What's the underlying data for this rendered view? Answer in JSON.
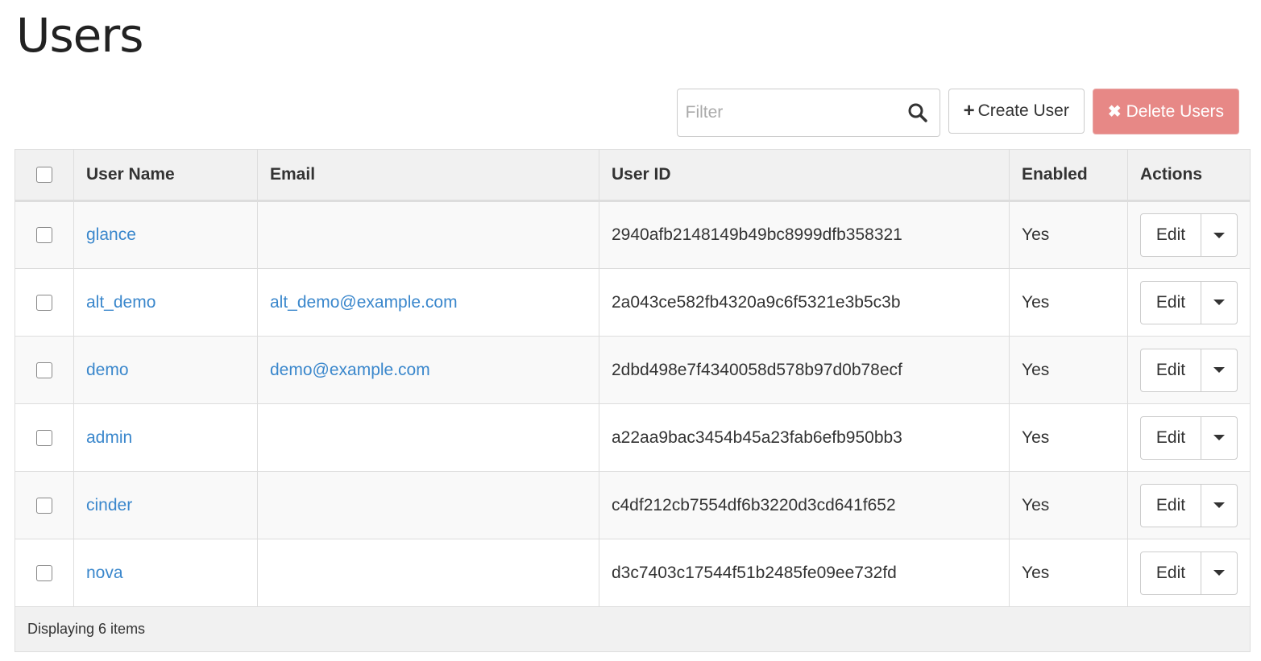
{
  "page": {
    "title": "Users"
  },
  "toolbar": {
    "filter_placeholder": "Filter",
    "create_label": "Create User",
    "create_glyph": "+",
    "delete_label": "Delete Users",
    "delete_glyph": "✖",
    "delete_color": "#e78886"
  },
  "table": {
    "headers": {
      "name": "User Name",
      "email": "Email",
      "id": "User ID",
      "enabled": "Enabled",
      "actions": "Actions"
    },
    "rows": [
      {
        "name": "glance",
        "email": "",
        "id": "2940afb2148149b49bc8999dfb358321",
        "enabled": "Yes",
        "action": "Edit"
      },
      {
        "name": "alt_demo",
        "email": "alt_demo@example.com",
        "id": "2a043ce582fb4320a9c6f5321e3b5c3b",
        "enabled": "Yes",
        "action": "Edit"
      },
      {
        "name": "demo",
        "email": "demo@example.com",
        "id": "2dbd498e7f4340058d578b97d0b78ecf",
        "enabled": "Yes",
        "action": "Edit"
      },
      {
        "name": "admin",
        "email": "",
        "id": "a22aa9bac3454b45a23fab6efb950bb3",
        "enabled": "Yes",
        "action": "Edit"
      },
      {
        "name": "cinder",
        "email": "",
        "id": "c4df212cb7554df6b3220d3cd641f652",
        "enabled": "Yes",
        "action": "Edit"
      },
      {
        "name": "nova",
        "email": "",
        "id": "d3c7403c17544f51b2485fe09ee732fd",
        "enabled": "Yes",
        "action": "Edit"
      }
    ],
    "footer": "Displaying 6 items"
  },
  "colors": {
    "link": "#3a87cc",
    "header_bg": "#f1f1f1"
  },
  "icons": {
    "search": "search-icon",
    "caret": "chevron-down-icon"
  }
}
